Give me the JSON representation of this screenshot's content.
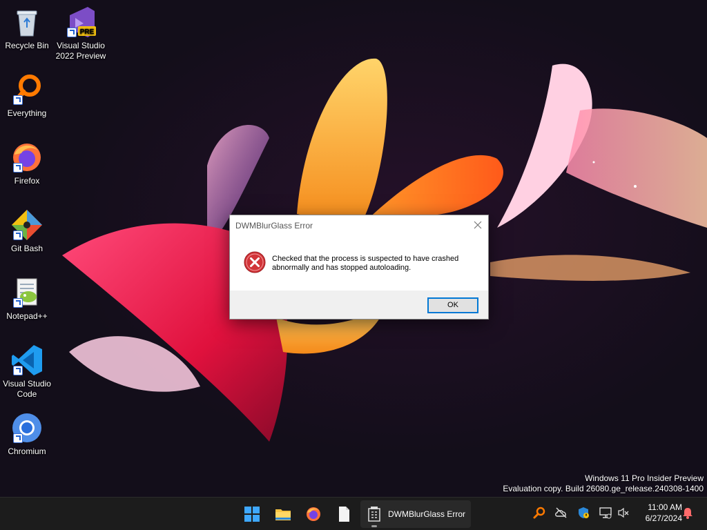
{
  "desktop": {
    "icons": [
      {
        "label": "Recycle Bin",
        "icon": "recycle-bin-icon"
      },
      {
        "label": "Visual Studio 2022 Preview",
        "icon": "visual-studio-icon",
        "badge": "PRE"
      },
      {
        "label": "Everything",
        "icon": "everything-search-icon"
      },
      {
        "label": "Firefox",
        "icon": "firefox-icon"
      },
      {
        "label": "Git Bash",
        "icon": "git-bash-icon"
      },
      {
        "label": "Notepad++",
        "icon": "notepad-plus-plus-icon"
      },
      {
        "label": "Visual Studio Code",
        "icon": "vscode-icon"
      },
      {
        "label": "Chromium",
        "icon": "chromium-icon"
      }
    ],
    "watermark": {
      "line1": "Windows 11 Pro Insider Preview",
      "line2": "Evaluation copy. Build 26080.ge_release.240308-1400"
    }
  },
  "dialog": {
    "title": "DWMBlurGlass Error",
    "message": "Checked that the process is suspected to have crashed abnormally and has stopped autoloading.",
    "ok_label": "OK",
    "icon": "error-icon"
  },
  "taskbar": {
    "pinned": [
      "start-icon",
      "file-explorer-icon",
      "firefox-icon",
      "notepad-icon"
    ],
    "active_app": {
      "label": "DWMBlurGlass Error",
      "icon": "dwmblurglass-icon"
    },
    "tray": [
      "everything-search-icon",
      "onedrive-offline-icon",
      "windows-security-icon",
      "network-icon",
      "volume-muted-icon"
    ],
    "clock": {
      "time": "11:00 AM",
      "date": "6/27/2024"
    },
    "notification_icon": "bell-icon"
  },
  "colors": {
    "accent": "#0078d4",
    "error": "#d13438",
    "taskbar": "#1c1c1c"
  }
}
